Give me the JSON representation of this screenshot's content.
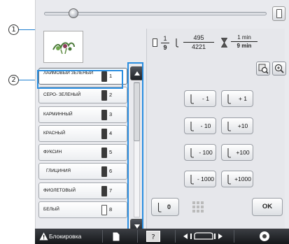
{
  "callouts": {
    "one": "1",
    "two": "2"
  },
  "thread_list": [
    {
      "name": "ЛАЙМОВЫЙ ЗЕЛЕНЫЙ",
      "number": "1",
      "swatch": "dark"
    },
    {
      "name": "СЕРО- ЗЕЛЕНЫЙ",
      "number": "2",
      "swatch": "dark"
    },
    {
      "name": "КАРМИННЫЙ",
      "number": "3",
      "swatch": "dark"
    },
    {
      "name": "КРАСНЫЙ",
      "number": "4",
      "swatch": "dark"
    },
    {
      "name": "ФУКСИН",
      "number": "5",
      "swatch": "dark"
    },
    {
      "name": "ГЛИЦИНИЯ",
      "number": "6",
      "swatch": "dark"
    },
    {
      "name": "ФИОЛЕТОВЫЙ",
      "number": "7",
      "swatch": "dark"
    },
    {
      "name": "БЕЛЫЙ",
      "number": "8",
      "swatch": "light"
    }
  ],
  "counter": {
    "color_current": "1",
    "color_total": "9",
    "stitch_current": "495",
    "stitch_total": "4221",
    "time_remaining": "1 min",
    "time_total": "9 min"
  },
  "stitch_buttons": [
    [
      "- 1",
      "+ 1"
    ],
    [
      "- 10",
      "+10"
    ],
    [
      "- 100",
      "+100"
    ],
    [
      "- 1000",
      "+1000"
    ]
  ],
  "bottom_row": {
    "zero_label": "0",
    "ok_label": "OK"
  },
  "bottombar": {
    "lock_label": "Блокировка"
  },
  "icons": [
    "warning-icon",
    "page-icon",
    "help-icon",
    "frame-move-icon",
    "sewing-icon",
    "magnify-icon",
    "zoom-icon",
    "spool-icon",
    "needle-icon",
    "hourglass-icon",
    "grid-icon"
  ]
}
